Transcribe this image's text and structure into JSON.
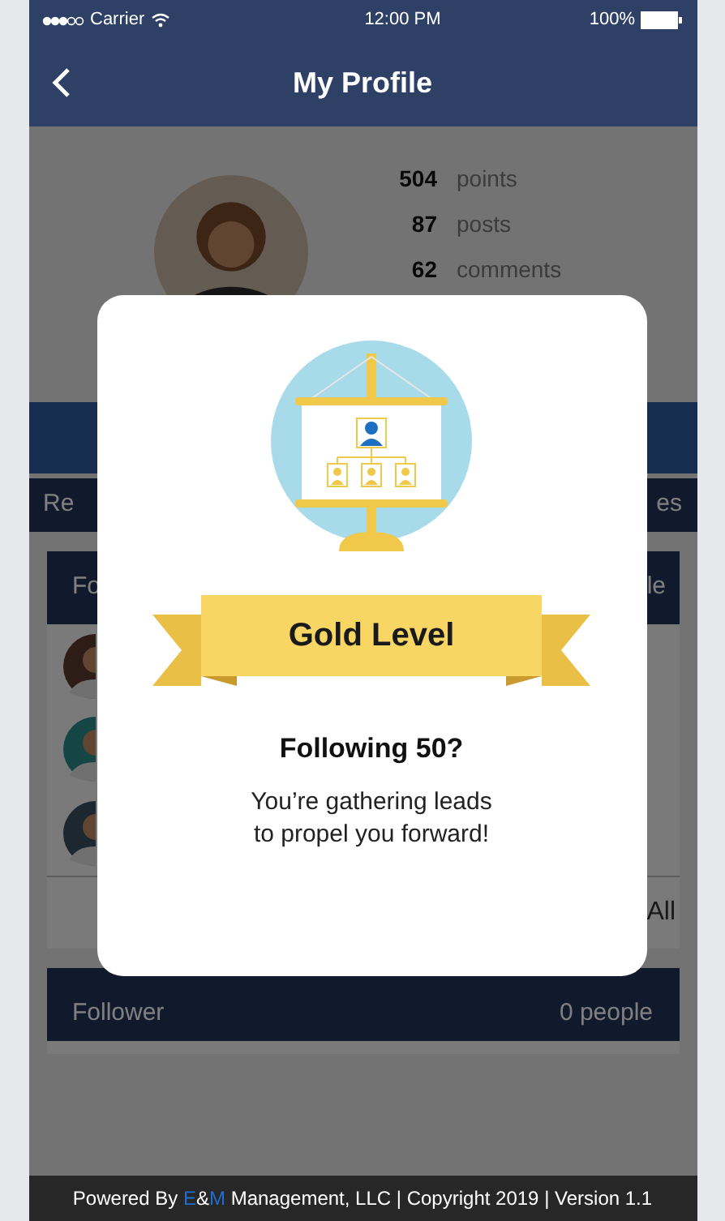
{
  "status_bar": {
    "carrier": "Carrier",
    "time": "12:00 PM",
    "battery": "100%"
  },
  "nav": {
    "title": "My Profile"
  },
  "stats": [
    {
      "value": "504",
      "label": "points"
    },
    {
      "value": "87",
      "label": "posts"
    },
    {
      "value": "62",
      "label": "comments"
    }
  ],
  "tabs": [
    {
      "label": "Re"
    },
    {
      "label": "es"
    }
  ],
  "following_card": {
    "title": "Fo",
    "count": "le",
    "see_all": "All"
  },
  "follower_card": {
    "title": "Follower",
    "count": "0 people"
  },
  "modal": {
    "level": "Gold Level",
    "title": "Following 50?",
    "message_lines": [
      "You’re gathering leads",
      "to propel you forward!"
    ]
  },
  "footer": {
    "segments": [
      {
        "text": "Powered By ",
        "color": "#ffffff"
      },
      {
        "text": "E",
        "color": "#1e6fd0"
      },
      {
        "text": "&",
        "color": "#ffffff"
      },
      {
        "text": "M",
        "color": "#1e6fd0"
      },
      {
        "text": " Management, LLC | Copyright 2019 | Version 1.1",
        "color": "#ffffff"
      }
    ]
  }
}
